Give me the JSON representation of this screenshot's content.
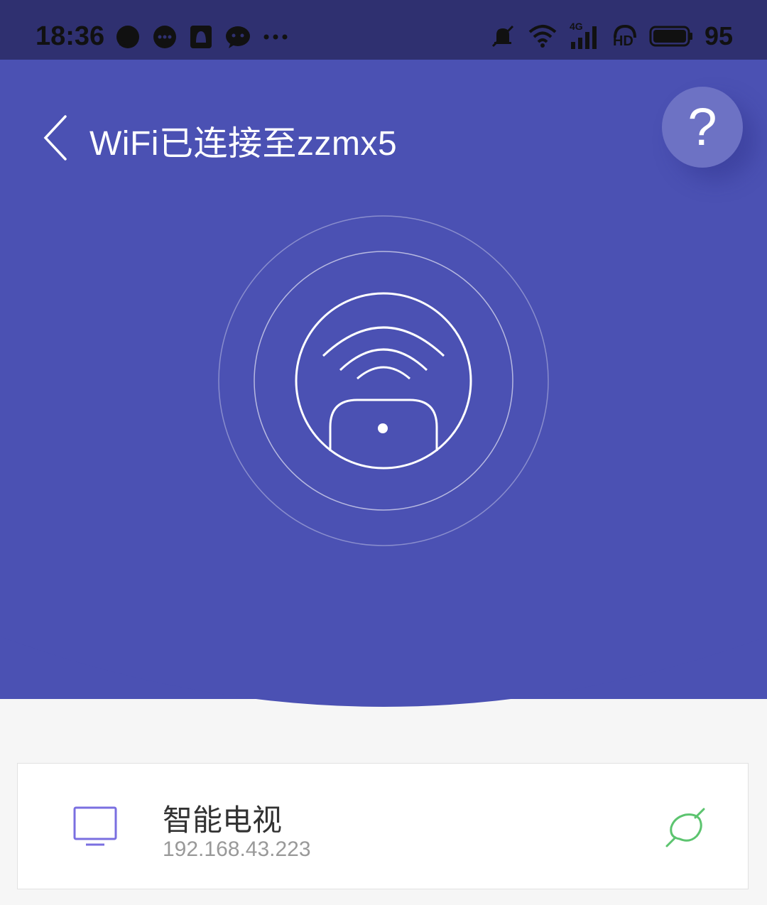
{
  "status_bar": {
    "time": "18:36",
    "left_icons": [
      "message-icon",
      "chat-icon",
      "notification-icon",
      "wechat-icon",
      "more-icon"
    ],
    "right_icons": [
      "mute-icon",
      "wifi-icon",
      "signal-4g-icon",
      "hd-icon",
      "battery-icon"
    ],
    "network_label": "4G",
    "hd_label": "HD",
    "battery": "95"
  },
  "header": {
    "title": "WiFi已连接至zzmx5",
    "help_label": "?"
  },
  "device": {
    "name": "智能电视",
    "ip": "192.168.43.223",
    "icon": "tv-icon",
    "action_icon": "link-icon"
  },
  "colors": {
    "hero": "#4b51b3",
    "accent_purple": "#7a6fe0",
    "link_green": "#5cc46f",
    "background": "#f6f6f6"
  }
}
